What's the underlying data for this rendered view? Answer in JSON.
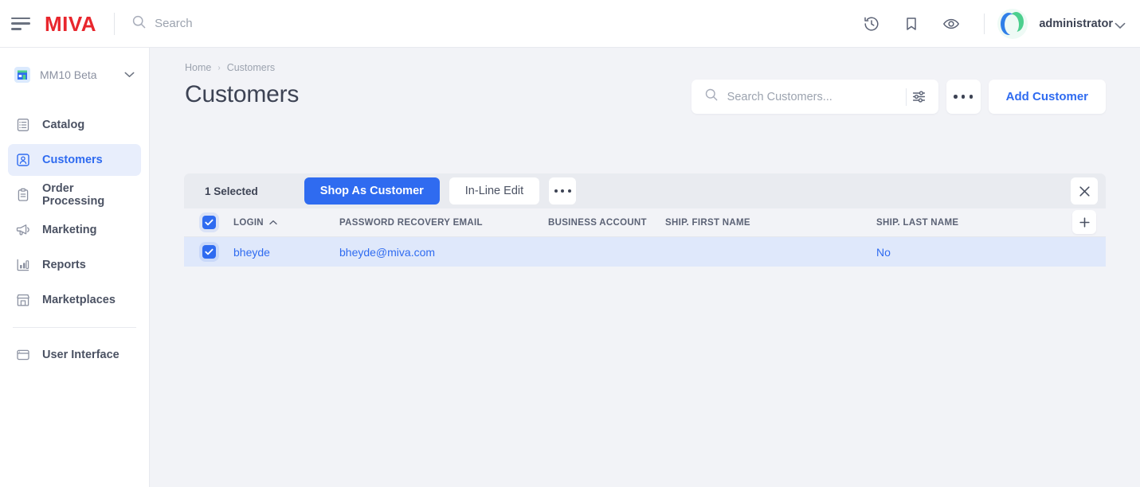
{
  "topbar": {
    "menu_icon": "hamburger-icon",
    "brand": "MIVA",
    "search_placeholder": "Search",
    "search_icon": "search-icon",
    "icons": [
      {
        "name": "history-icon",
        "label": "History"
      },
      {
        "name": "bookmark-icon",
        "label": "Bookmarks"
      },
      {
        "name": "eye-icon",
        "label": "Preview"
      }
    ],
    "user": "administrator",
    "user_caret_icon": "chevron-down-icon",
    "avatar_icon": "miva-avatar"
  },
  "sidebar": {
    "store": {
      "name": "MM10 Beta",
      "icon": "store-icon",
      "caret_icon": "chevron-down-icon"
    },
    "items": [
      {
        "label": "Catalog",
        "icon": "catalog-icon",
        "active": false
      },
      {
        "label": "Customers",
        "icon": "customers-icon",
        "active": true
      },
      {
        "label": "Order Processing",
        "icon": "clipboard-icon",
        "active": false
      },
      {
        "label": "Marketing",
        "icon": "megaphone-icon",
        "active": false
      },
      {
        "label": "Reports",
        "icon": "bar-chart-icon",
        "active": false
      },
      {
        "label": "Marketplaces",
        "icon": "storefront-icon",
        "active": false
      }
    ],
    "items_after_divider": [
      {
        "label": "User Interface",
        "icon": "window-icon",
        "active": false
      }
    ]
  },
  "main": {
    "breadcrumb": {
      "home": "Home",
      "separator": "›",
      "current": "Customers"
    },
    "page_title": "Customers",
    "search": {
      "placeholder": "Search Customers...",
      "icon": "search-icon",
      "filter_icon": "sliders-icon"
    },
    "more_button": "more-options-icon",
    "add_button": "Add Customer"
  },
  "selection_toolbar": {
    "count_label": "1 Selected",
    "shop_as_customer": "Shop As Customer",
    "inline_edit": "In-Line Edit",
    "more_icon": "more-options-icon",
    "close_icon": "close-icon"
  },
  "table": {
    "select_all_checked": true,
    "sort_column": "LOGIN",
    "sort_direction": "asc",
    "sort_icon": "chevron-up-icon",
    "add_column_icon": "plus-icon",
    "columns": [
      "LOGIN",
      "PASSWORD RECOVERY EMAIL",
      "BUSINESS ACCOUNT",
      "SHIP. FIRST NAME",
      "SHIP. LAST NAME"
    ],
    "rows": [
      {
        "selected": true,
        "login": "bheyde",
        "email": "bheyde@miva.com",
        "business_account": "",
        "ship_first_name": "",
        "ship_last_name": "No"
      }
    ]
  },
  "colors": {
    "brand_red": "#e8262d",
    "accent_blue": "#2f6bf0",
    "row_selected_bg": "#dfe8fb",
    "main_bg": "#f2f3f7",
    "toolbar_bg": "#e9ebf0",
    "nav_active_bg": "#e8eefc"
  }
}
